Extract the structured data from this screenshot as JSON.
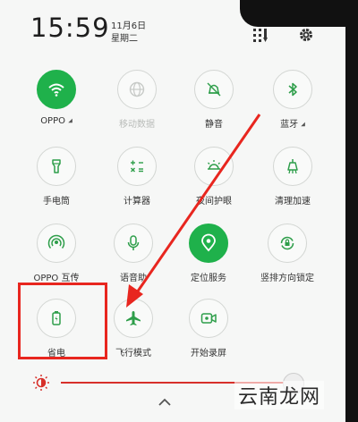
{
  "status": {
    "time": "15:59",
    "date": "11月6日",
    "weekday": "星期二"
  },
  "header_icons": [
    "edit-tiles-icon",
    "settings-gear-icon"
  ],
  "tiles": [
    {
      "label": "OPPO",
      "icon": "wifi-icon",
      "active": true,
      "has_menu": true
    },
    {
      "label": "移动数据",
      "icon": "mobile-data-icon",
      "active": false,
      "disabled": true
    },
    {
      "label": "静音",
      "icon": "mute-bell-icon",
      "active": false
    },
    {
      "label": "蓝牙",
      "icon": "bluetooth-icon",
      "active": false,
      "has_menu": true
    },
    {
      "label": "手电筒",
      "icon": "flashlight-icon",
      "active": false
    },
    {
      "label": "计算器",
      "icon": "calculator-icon",
      "active": false
    },
    {
      "label": "夜间护眼",
      "icon": "night-mode-icon",
      "active": false
    },
    {
      "label": "清理加速",
      "icon": "clean-boost-icon",
      "active": false
    },
    {
      "label": "OPPO 互传",
      "icon": "share-icon",
      "active": false
    },
    {
      "label": "语音助",
      "icon": "microphone-icon",
      "active": false
    },
    {
      "label": "定位服务",
      "icon": "location-icon",
      "active": true
    },
    {
      "label": "竖排方向锁定",
      "icon": "rotation-lock-icon",
      "active": false
    },
    {
      "label": "省电",
      "icon": "battery-saver-icon",
      "active": false
    },
    {
      "label": "飞行模式",
      "icon": "airplane-icon",
      "active": false
    },
    {
      "label": "开始录屏",
      "icon": "screen-record-icon",
      "active": false
    }
  ],
  "brightness": {
    "level": 0.82,
    "icon": "brightness-sun-icon"
  },
  "watermark": "云南龙网",
  "colors": {
    "active": "#1fb14b",
    "highlight": "#e8261f",
    "icon": "#2e9e4a"
  }
}
